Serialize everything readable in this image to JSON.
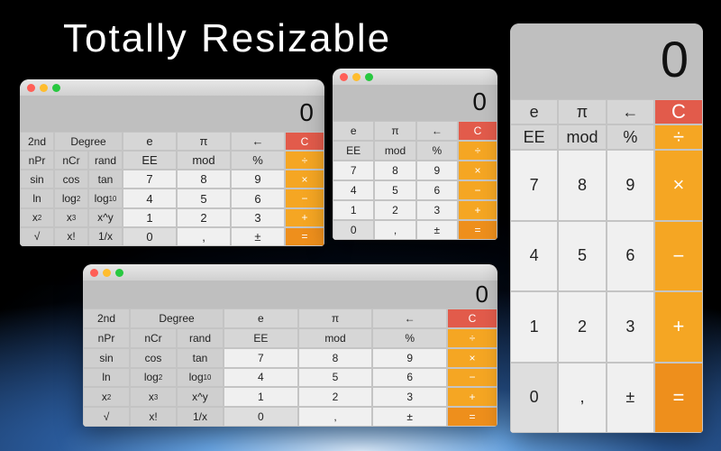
{
  "headline": "Totally Resizable",
  "display_value": "0",
  "traffic_lights": [
    "close",
    "minimize",
    "zoom"
  ],
  "sci_rows": [
    [
      "2nd",
      "Degree",
      "",
      "",
      "e",
      "π",
      "←",
      "C"
    ],
    [
      "nPr",
      "nCr",
      "rand",
      "EE",
      "mod",
      "%",
      "÷"
    ],
    [
      "sin",
      "cos",
      "tan",
      "7",
      "8",
      "9",
      "×"
    ],
    [
      "ln",
      "log₂",
      "log₁₀",
      "4",
      "5",
      "6",
      "−"
    ],
    [
      "x²",
      "x³",
      "xʸy",
      "1",
      "2",
      "3",
      "+"
    ],
    [
      "√",
      "x!",
      "1/x",
      "0",
      ",",
      "±",
      "="
    ]
  ],
  "basic_rows": [
    [
      "e",
      "π",
      "←",
      "C"
    ],
    [
      "EE",
      "mod",
      "%",
      "÷"
    ],
    [
      "7",
      "8",
      "9",
      "×"
    ],
    [
      "4",
      "5",
      "6",
      "−"
    ],
    [
      "1",
      "2",
      "3",
      "+"
    ],
    [
      "0",
      ",",
      "±",
      "="
    ]
  ]
}
